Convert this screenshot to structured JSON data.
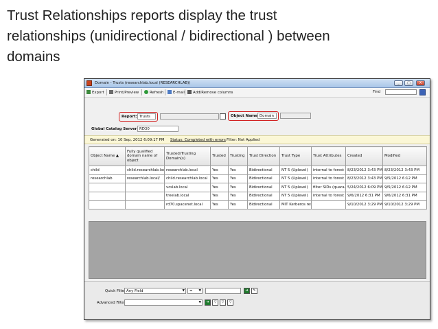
{
  "headline": {
    "line1": "Trust Relationships reports display the trust",
    "line2": "relationships (unidirectional / bidirectional ) between",
    "line3": "domains"
  },
  "window": {
    "title": "Domain - Trusts (researchlab.local (RESEARCHLAB))",
    "buttons": [
      "_",
      "□",
      "X"
    ]
  },
  "toolbar": {
    "export": "Export",
    "print_preview": "Print/Preview",
    "refresh": "Refresh",
    "email": "E-mail",
    "add_remove": "Add/Remove columns",
    "find_label": "Find"
  },
  "controls": {
    "report_label": "Report:",
    "report_value": "Trusts",
    "object_label": "Object Name:",
    "object_value": "Domain",
    "gc_label": "Global Catalog Server:",
    "gc_value": "RD30"
  },
  "status": {
    "generated": "Generated on: 10 Sep, 2012 6:09:17 PM",
    "status": "Status: Completed with errors",
    "filter": "Filter: Not Applied"
  },
  "table": {
    "headers": [
      "Object Name",
      "Fully qualified domain name of object",
      "Trusted/Trusting Domain(s)",
      "Trusted",
      "Trusting",
      "Trust Direction",
      "Trust Type",
      "Trust Attributes",
      "Created",
      "Modified"
    ],
    "sort_indicator": "▲",
    "rows": [
      [
        "child",
        "child.researchlab.local/",
        "researchlab.local",
        "Yes",
        "Yes",
        "Bidirectional",
        "NT 5 (Uplevel)",
        "internal to forest",
        "8/23/2012 3:43 PM",
        "8/23/2012 3:43 PM"
      ],
      [
        "researchlab",
        "researchlab.local/",
        "child.researchlab.local",
        "Yes",
        "Yes",
        "Bidirectional",
        "NT 5 (Uplevel)",
        "internal to forest",
        "8/23/2012 3:43 PM",
        "9/5/2012 6:12 PM"
      ],
      [
        "",
        "",
        "vcslab.local",
        "Yes",
        "Yes",
        "Bidirectional",
        "NT 5 (Uplevel)",
        "filter SIDs (quara...",
        "5/24/2012 6:09 PM",
        "9/5/2012 6:12 PM"
      ],
      [
        "",
        "",
        "treelab.local",
        "Yes",
        "Yes",
        "Bidirectional",
        "NT 5 (Uplevel)",
        "internal to forest",
        "9/6/2012 6:31 PM",
        "9/6/2012 6:31 PM"
      ],
      [
        "",
        "",
        "rd70.spacenet.local",
        "Yes",
        "Yes",
        "Bidirectional",
        "MIT Kerberos res...",
        "",
        "9/10/2012 3:29 PM",
        "9/10/2012 3:29 PM"
      ]
    ]
  },
  "filters": {
    "quick_label": "Quick Filter:",
    "quick_field": "Any Field",
    "quick_op": "=",
    "advanced_label": "Advanced Filters:"
  },
  "colors": {
    "highlight": "#d21f1f",
    "titlebar": "#a9c6e8",
    "status_bg": "#fbf7d6",
    "empty_grid": "#a4a4a4"
  }
}
